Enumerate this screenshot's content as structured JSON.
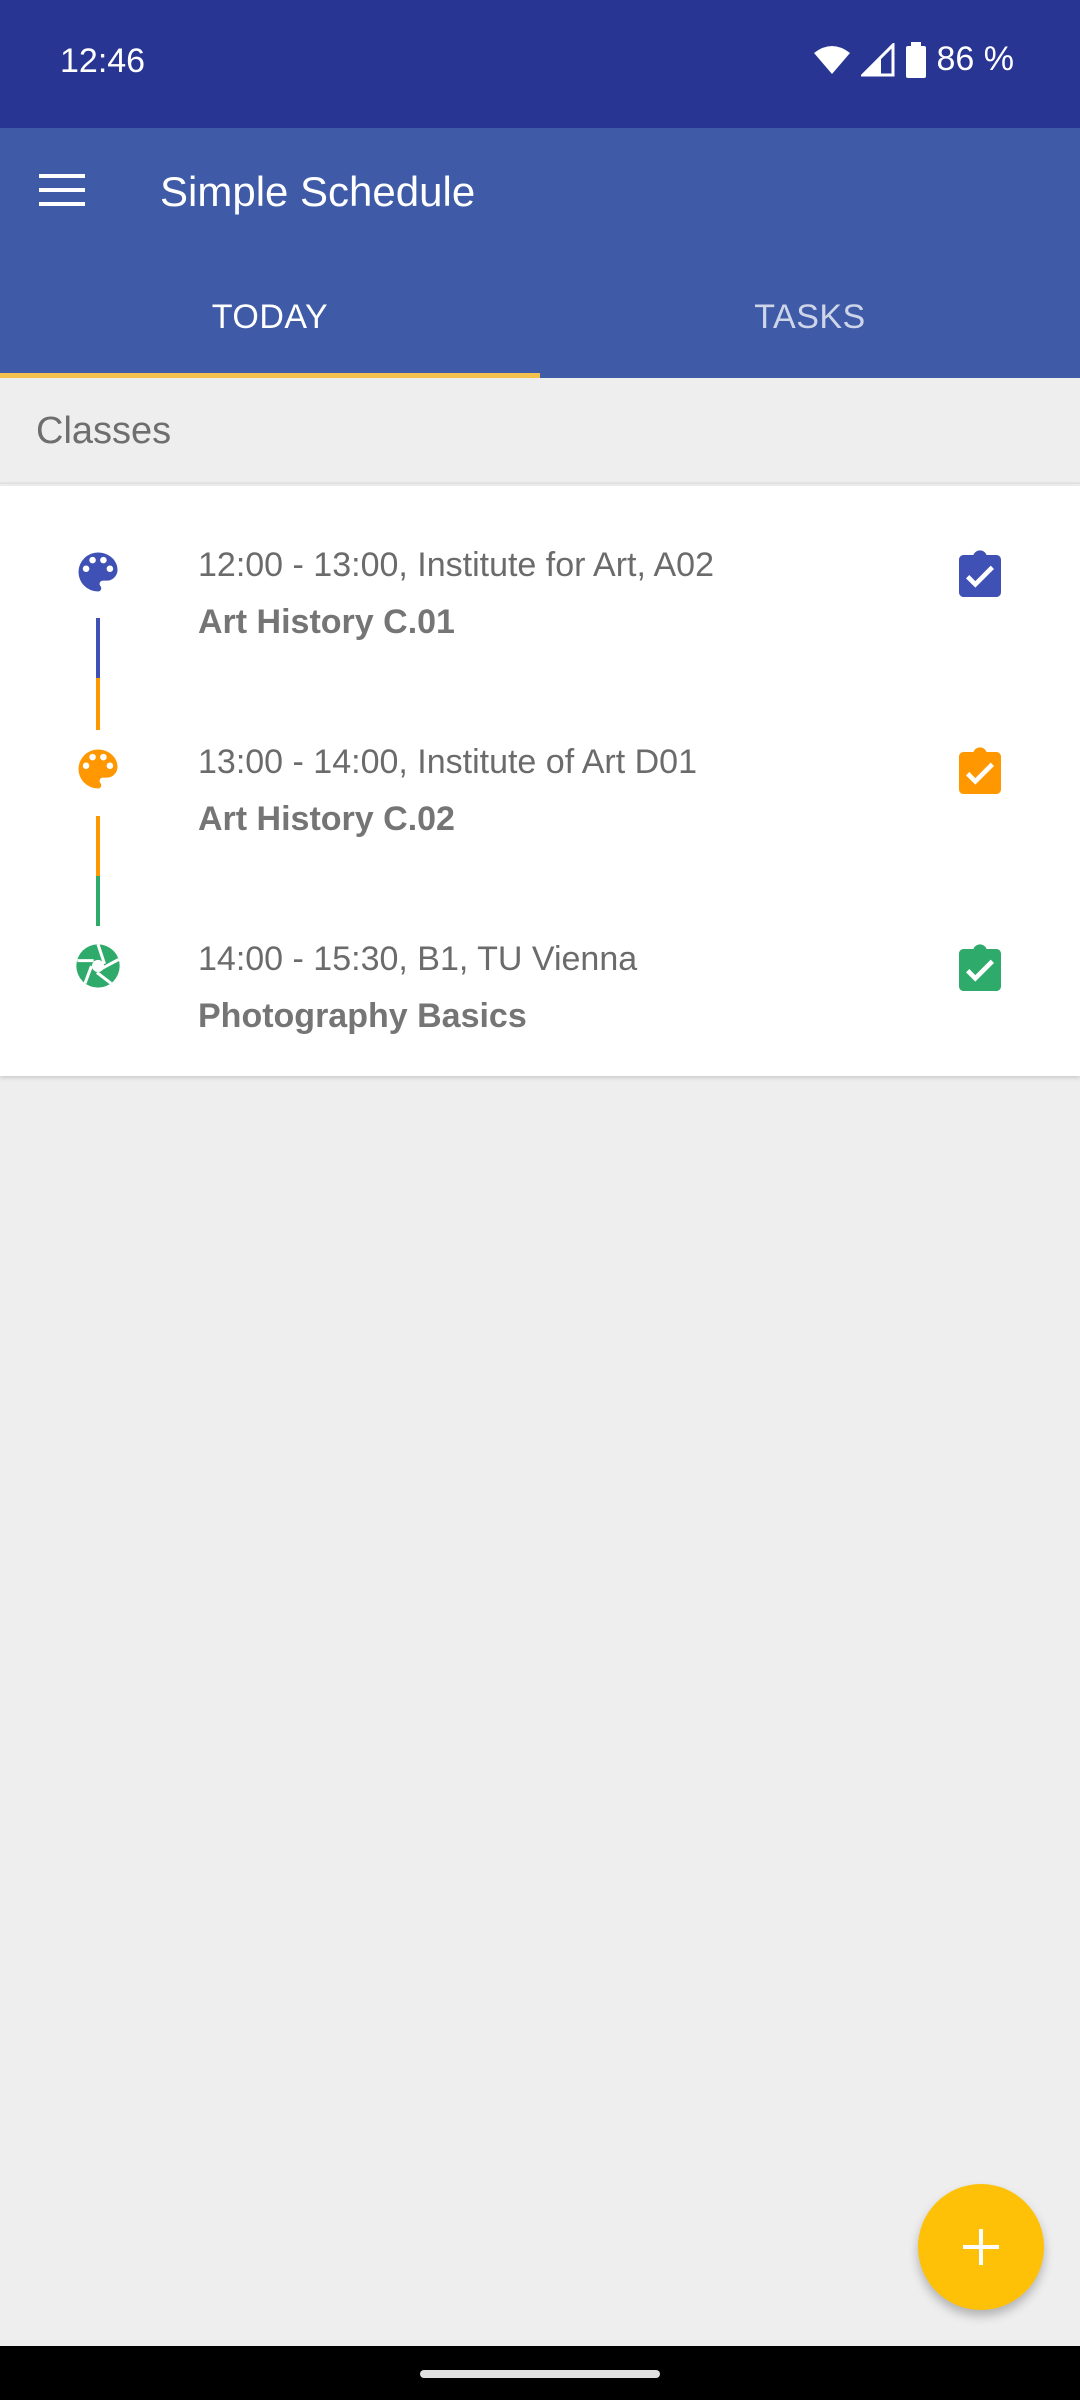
{
  "status_bar": {
    "time": "12:46",
    "battery": "86 %",
    "icons": [
      "wifi-icon",
      "signal-icon",
      "battery-icon"
    ]
  },
  "app_bar": {
    "title": "Simple Schedule",
    "menu_icon": "menu-icon"
  },
  "tabs": [
    {
      "label": "TODAY",
      "selected": true
    },
    {
      "label": "TASKS",
      "selected": false
    }
  ],
  "section": {
    "title": "Classes"
  },
  "classes": [
    {
      "time": "12:00 - 13:00, Institute for Art, A02",
      "name": "Art History C.01",
      "icon": "palette-icon",
      "color": "#3f51b5"
    },
    {
      "time": "13:00 - 14:00, Institute of Art D01",
      "name": "Art History C.02",
      "icon": "palette-icon",
      "color": "#ff9800"
    },
    {
      "time": "14:00 - 15:30, B1, TU Vienna",
      "name": "Photography Basics",
      "icon": "camera-aperture-icon",
      "color": "#2eaa6a"
    }
  ],
  "colors": {
    "status_bar": "#283593",
    "app_bar": "#3f5aa6",
    "accent": "#ffc107",
    "tab_indicator": "#f2c14e"
  },
  "fab": {
    "icon": "plus-icon"
  }
}
